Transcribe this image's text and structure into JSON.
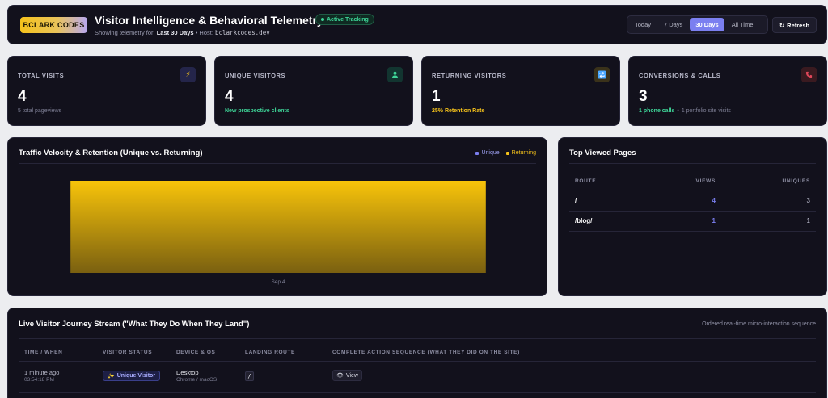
{
  "header": {
    "logo": "BCLARK CODES",
    "title": "Visitor Intelligence & Behavioral Telemetry",
    "status_badge": "Active Tracking",
    "subtitle_prefix": "Showing telemetry for:",
    "subtitle_range": "Last 30 Days",
    "subtitle_host_label": "• Host:",
    "host": "bclarkcodes.dev",
    "ranges": [
      "Today",
      "7 Days",
      "30 Days",
      "All Time"
    ],
    "active_range": "30 Days",
    "refresh_label": "Refresh"
  },
  "stats": [
    {
      "label": "TOTAL VISITS",
      "value": "4",
      "foot": "5 total pageviews",
      "icon": "lightning-icon",
      "glyph": "⚡",
      "icon_bg": "#24254a",
      "icon_color": "#f5c21b"
    },
    {
      "label": "UNIQUE VISITORS",
      "value": "4",
      "foot": "New prospective clients",
      "icon": "user-icon",
      "glyph": "👤",
      "icon_bg": "#123530",
      "icon_color": "#3ed598"
    },
    {
      "label": "RETURNING VISITORS",
      "value": "1",
      "foot": "25% Retention Rate",
      "icon": "repeat-icon",
      "glyph": "🔁",
      "icon_bg": "#3a321a",
      "icon_color": "#4aa8ff"
    },
    {
      "label": "CONVERSIONS & CALLS",
      "value": "3",
      "foot_a": "1 phone calls",
      "foot_b": "1 portfolio site visits",
      "icon": "phone-icon",
      "glyph": "📞",
      "icon_bg": "#3a1a20",
      "icon_color": "#e0475a"
    }
  ],
  "chart": {
    "title": "Traffic Velocity & Retention (Unique vs. Returning)",
    "legend_unique": "Unique",
    "legend_returning": "Returning"
  },
  "chart_data": {
    "type": "bar",
    "categories": [
      "Sep 4"
    ],
    "series": [
      {
        "name": "Unique",
        "values": [
          0
        ],
        "color": "#7b7ff0"
      },
      {
        "name": "Returning",
        "values": [
          1
        ],
        "color": "#f5c21b"
      }
    ],
    "title": "Traffic Velocity & Retention (Unique vs. Returning)",
    "xlabel": "",
    "ylabel": "",
    "ylim": [
      0,
      1
    ],
    "grid": false,
    "legend": "top-right"
  },
  "pages": {
    "title": "Top Viewed Pages",
    "columns": [
      "ROUTE",
      "VIEWS",
      "UNIQUES"
    ],
    "rows": [
      {
        "route": "/",
        "views": "4",
        "uniques": "3"
      },
      {
        "route": "/blog/",
        "views": "1",
        "uniques": "1"
      }
    ]
  },
  "journey": {
    "title": "Live Visitor Journey Stream (\"What They Do When They Land\")",
    "subtitle": "Ordered real-time micro-interaction sequence",
    "columns": [
      "TIME / WHEN",
      "VISITOR STATUS",
      "DEVICE & OS",
      "LANDING ROUTE",
      "COMPLETE ACTION SEQUENCE (WHAT THEY DID ON THE SITE)"
    ],
    "rows": [
      {
        "when": "1 minute ago",
        "time": "03:54:18 PM",
        "status": "Unique Visitor",
        "device": "Desktop",
        "os": "Chrome / macOS",
        "route": "/",
        "action": "View"
      }
    ]
  },
  "colors": {
    "accent": "#7b7ff0",
    "returning": "#f5c21b",
    "success": "#3ed598",
    "panel": "#12111c"
  }
}
